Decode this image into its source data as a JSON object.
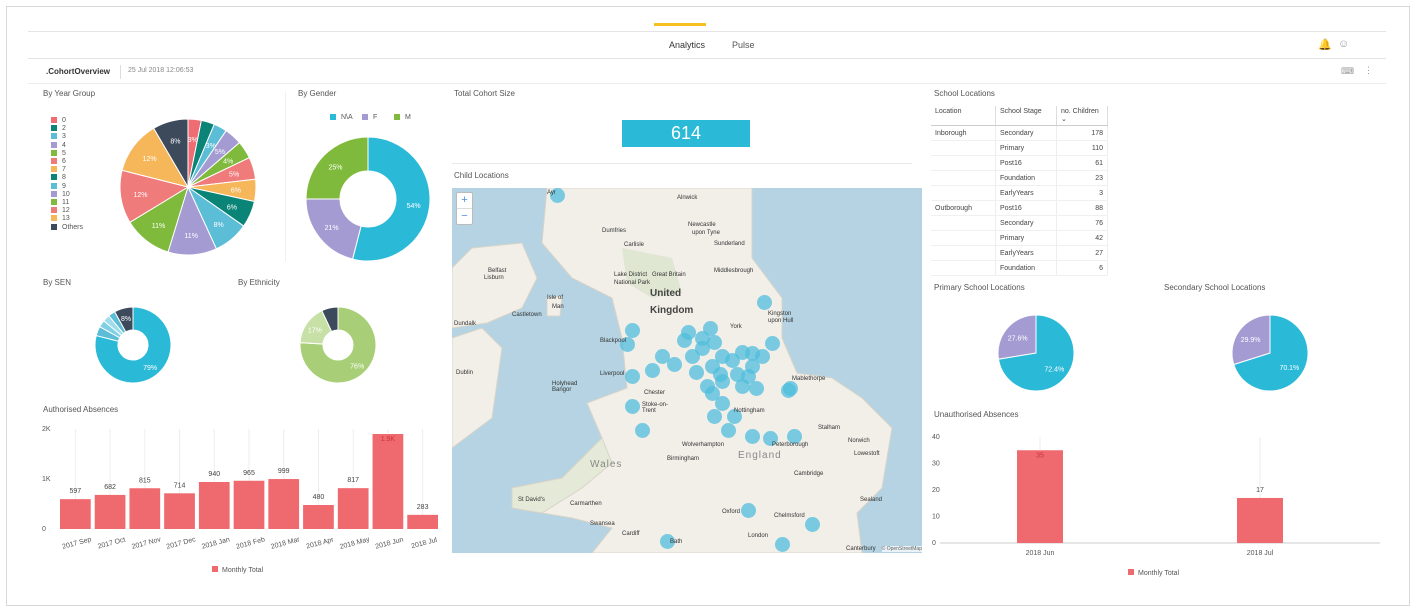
{
  "nav": {
    "tabs": [
      {
        "label": "Analytics"
      },
      {
        "label": "Pulse"
      }
    ]
  },
  "header": {
    "title": ".CohortOverview",
    "timestamp": "25 Jul 2018 12:06:53"
  },
  "panels": {
    "year_group": "By Year Group",
    "gender": "By Gender",
    "total": "Total Cohort Size",
    "child_locations": "Child Locations",
    "school_locations": "School Locations",
    "sen": "By SEN",
    "ethnicity": "By Ethnicity",
    "authorised": "Authorised Absences",
    "primary_locations": "Primary School Locations",
    "secondary_locations": "Secondary School Locations",
    "unauthorised": "Unauthorised Absences"
  },
  "total_cohort": "614",
  "year_group_legend": [
    {
      "label": "0",
      "color": "#ee6c72"
    },
    {
      "label": "2",
      "color": "#0b8478"
    },
    {
      "label": "3",
      "color": "#5bbdd6"
    },
    {
      "label": "4",
      "color": "#a59bd3"
    },
    {
      "label": "5",
      "color": "#7fba3c"
    },
    {
      "label": "6",
      "color": "#f07b7b"
    },
    {
      "label": "7",
      "color": "#f6b65a"
    },
    {
      "label": "8",
      "color": "#0b8478"
    },
    {
      "label": "9",
      "color": "#5bbdd6"
    },
    {
      "label": "10",
      "color": "#a59bd3"
    },
    {
      "label": "11",
      "color": "#7fba3c"
    },
    {
      "label": "12",
      "color": "#f07b7b"
    },
    {
      "label": "13",
      "color": "#f6b65a"
    },
    {
      "label": "Others",
      "color": "#3d4a5c"
    }
  ],
  "gender_legend": [
    {
      "label": "N\\A",
      "color": "#2ab9d7"
    },
    {
      "label": "F",
      "color": "#a59bd3"
    },
    {
      "label": "M",
      "color": "#7fba3c"
    }
  ],
  "school_table": {
    "headers": [
      "Location",
      "School Stage",
      "no. Children"
    ],
    "groups": [
      {
        "location": "Inborough",
        "rows": [
          [
            "Secondary",
            "178"
          ],
          [
            "Primary",
            "110"
          ],
          [
            "Post16",
            "61"
          ],
          [
            "Foundation",
            "23"
          ],
          [
            "EarlyYears",
            "3"
          ]
        ]
      },
      {
        "location": "Outborough",
        "rows": [
          [
            "Post16",
            "88"
          ],
          [
            "Secondary",
            "76"
          ],
          [
            "Primary",
            "42"
          ],
          [
            "EarlyYears",
            "27"
          ],
          [
            "Foundation",
            "6"
          ]
        ]
      }
    ]
  },
  "map": {
    "zoom_in": "+",
    "zoom_out": "−",
    "attribution": "© OpenStreetMap",
    "labels": [
      {
        "t": "United",
        "c": "big"
      },
      {
        "t": "Kingdom",
        "c": "big"
      },
      {
        "t": "England",
        "c": "big2"
      },
      {
        "t": "Wales",
        "c": "big2"
      },
      {
        "t": "Ayr"
      },
      {
        "t": "Dumfries"
      },
      {
        "t": "Carlisle"
      },
      {
        "t": "Newcastle"
      },
      {
        "t": "upon Tyne"
      },
      {
        "t": "Sunderland"
      },
      {
        "t": "Alnwick"
      },
      {
        "t": "Belfast"
      },
      {
        "t": "Lisburn"
      },
      {
        "t": "Lake District"
      },
      {
        "t": "National Park"
      },
      {
        "t": "Great Britain"
      },
      {
        "t": "Middlesbrough"
      },
      {
        "t": "Isle of"
      },
      {
        "t": "Man"
      },
      {
        "t": "Castletown"
      },
      {
        "t": "Dundalk"
      },
      {
        "t": "York"
      },
      {
        "t": "Kingston"
      },
      {
        "t": "upon Hull"
      },
      {
        "t": "Blackpool"
      },
      {
        "t": "Dublin"
      },
      {
        "t": "Liverpool"
      },
      {
        "t": "Holyhead"
      },
      {
        "t": "Bangor"
      },
      {
        "t": "Chester"
      },
      {
        "t": "Stoke-on-"
      },
      {
        "t": "Trent"
      },
      {
        "t": "Nottingham"
      },
      {
        "t": "Mablethorpe"
      },
      {
        "t": "Wolverhampton"
      },
      {
        "t": "Birmingham"
      },
      {
        "t": "Peterborough"
      },
      {
        "t": "Norwich"
      },
      {
        "t": "Stalham"
      },
      {
        "t": "Lowestoft"
      },
      {
        "t": "Cambridge"
      },
      {
        "t": "St David's"
      },
      {
        "t": "Carmarthen"
      },
      {
        "t": "Swansea"
      },
      {
        "t": "Cardiff"
      },
      {
        "t": "Oxford"
      },
      {
        "t": "Chelmsford"
      },
      {
        "t": "Sealand"
      },
      {
        "t": "London"
      },
      {
        "t": "Bath"
      },
      {
        "t": "Canterbury"
      }
    ]
  },
  "chart_data": [
    {
      "type": "pie",
      "title": "By Year Group",
      "categories": [
        "0",
        "2",
        "3",
        "4",
        "5",
        "6",
        "7",
        "8",
        "9",
        "10",
        "11",
        "12",
        "13",
        "Others"
      ],
      "values": [
        3,
        3,
        3,
        4,
        4,
        5,
        5,
        6,
        8,
        11,
        11,
        12,
        12,
        8
      ],
      "data_labels": [
        "3%",
        "",
        "3%",
        "5%",
        "4%",
        "5%",
        "6%",
        "6%",
        "8%",
        "11%",
        "11%",
        "12%",
        "12%",
        "8%"
      ]
    },
    {
      "type": "pie",
      "title": "By Gender",
      "donut": true,
      "categories": [
        "N\\A",
        "F",
        "M"
      ],
      "values": [
        54,
        21,
        25
      ]
    },
    {
      "type": "pie",
      "title": "By SEN",
      "donut": true,
      "values": [
        79,
        4,
        3,
        3,
        3,
        8
      ],
      "data_labels": [
        "79%",
        "",
        "",
        "",
        "",
        "8%"
      ]
    },
    {
      "type": "pie",
      "title": "By Ethnicity",
      "donut": true,
      "values": [
        76,
        17,
        7
      ],
      "data_labels": [
        "76%",
        "17%",
        ""
      ]
    },
    {
      "type": "bar",
      "title": "Authorised Absences",
      "categories": [
        "2017 Sep",
        "2017 Oct",
        "2017 Nov",
        "2017 Dec",
        "2018 Jan",
        "2018 Feb",
        "2018 Mar",
        "2018 Apr",
        "2018 May",
        "2018 Jun",
        "2018 Jul"
      ],
      "values": [
        597,
        682,
        815,
        714,
        940,
        965,
        999,
        480,
        817,
        1900,
        283
      ],
      "data_labels": [
        "597",
        "682",
        "815",
        "714",
        "940",
        "965",
        "999",
        "480",
        "817",
        "1.9K",
        "283"
      ],
      "y_ticks": [
        "0",
        "1K",
        "2K"
      ],
      "ylim": [
        0,
        2000
      ],
      "legend": "Monthly Total"
    },
    {
      "type": "pie",
      "title": "Primary School Locations",
      "values": [
        72.4,
        27.6
      ],
      "data_labels": [
        "72.4%",
        "27.6%"
      ]
    },
    {
      "type": "pie",
      "title": "Secondary School Locations",
      "values": [
        70.1,
        29.9
      ],
      "data_labels": [
        "70.1%",
        "29.9%"
      ]
    },
    {
      "type": "bar",
      "title": "Unauthorised Absences",
      "categories": [
        "2018 Jun",
        "2018 Jul"
      ],
      "values": [
        35,
        17
      ],
      "y_ticks": [
        "0",
        "10",
        "20",
        "30",
        "40"
      ],
      "ylim": [
        0,
        40
      ],
      "legend": "Monthly Total"
    }
  ],
  "colors": {
    "accent": "#f4c11f",
    "teal": "#2ab9d7",
    "bar": "#ef6a6e",
    "purple": "#a59bd3",
    "green": "#7fba3c",
    "lightgreen": "#a8cf78",
    "dark": "#3d4a5c"
  }
}
